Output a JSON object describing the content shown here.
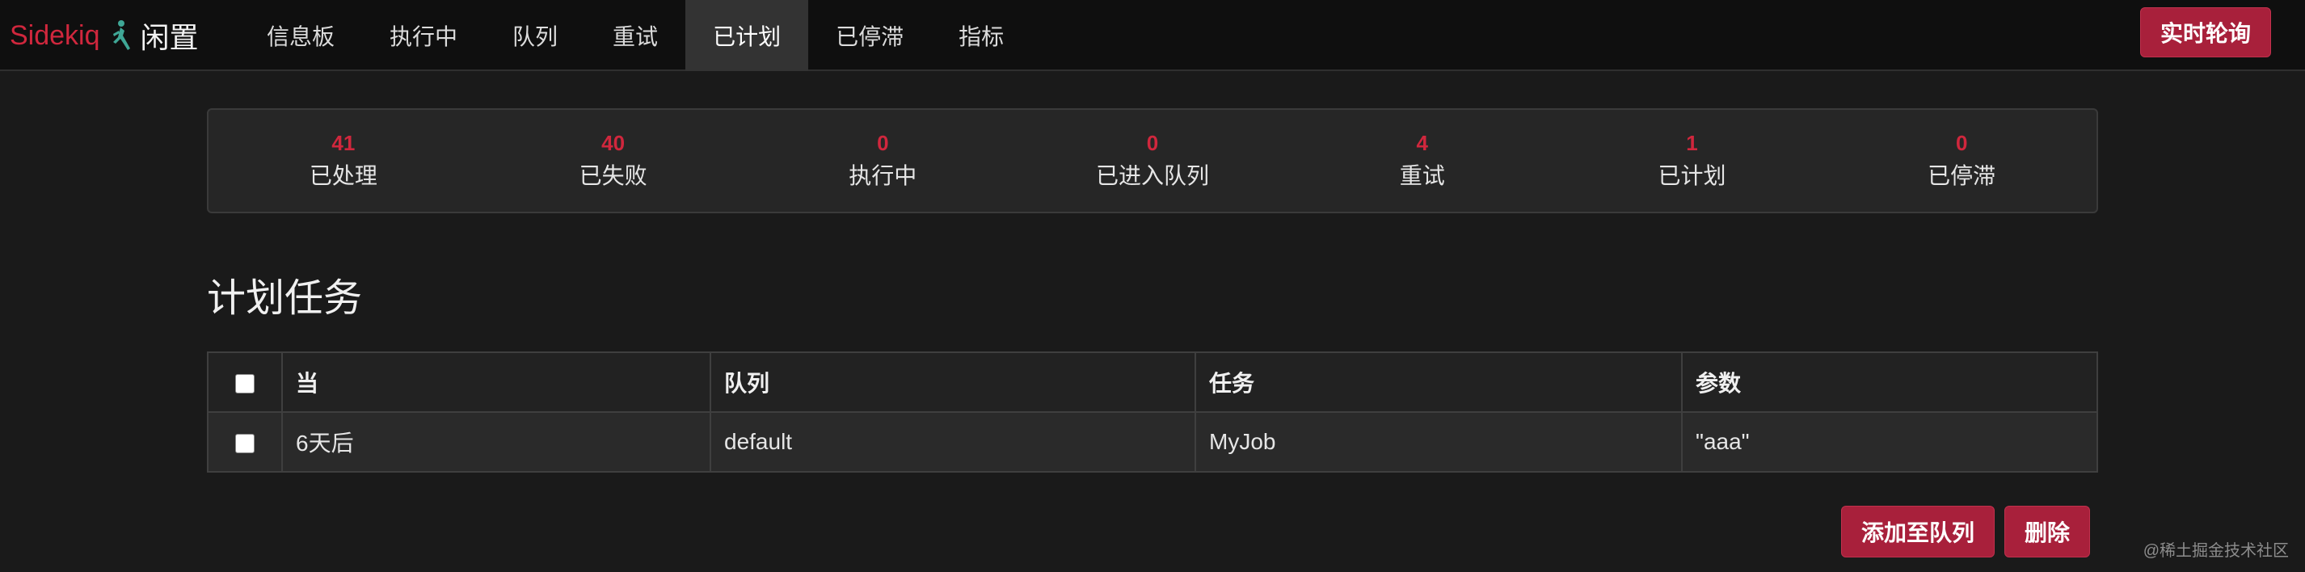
{
  "brand": {
    "name": "Sidekiq",
    "status": "闲置"
  },
  "nav": {
    "items": [
      {
        "label": "信息板",
        "active": false
      },
      {
        "label": "执行中",
        "active": false
      },
      {
        "label": "队列",
        "active": false
      },
      {
        "label": "重试",
        "active": false
      },
      {
        "label": "已计划",
        "active": true
      },
      {
        "label": "已停滞",
        "active": false
      },
      {
        "label": "指标",
        "active": false
      }
    ],
    "live_poll_label": "实时轮询"
  },
  "summary": [
    {
      "count": "41",
      "label": "已处理"
    },
    {
      "count": "40",
      "label": "已失败"
    },
    {
      "count": "0",
      "label": "执行中"
    },
    {
      "count": "0",
      "label": "已进入队列"
    },
    {
      "count": "4",
      "label": "重试"
    },
    {
      "count": "1",
      "label": "已计划"
    },
    {
      "count": "0",
      "label": "已停滞"
    }
  ],
  "page_title": "计划任务",
  "table": {
    "headers": {
      "when": "当",
      "queue": "队列",
      "job": "任务",
      "arguments": "参数"
    },
    "rows": [
      {
        "when": "6天后",
        "queue": "default",
        "job": "MyJob",
        "arguments": "\"aaa\""
      }
    ]
  },
  "actions": {
    "add_to_queue_label": "添加至队列",
    "delete_label": "删除"
  },
  "watermark": "@稀土掘金技术社区",
  "colors": {
    "accent": "#a8203b",
    "brand_red": "#d0273d",
    "background": "#1a1a1a"
  }
}
